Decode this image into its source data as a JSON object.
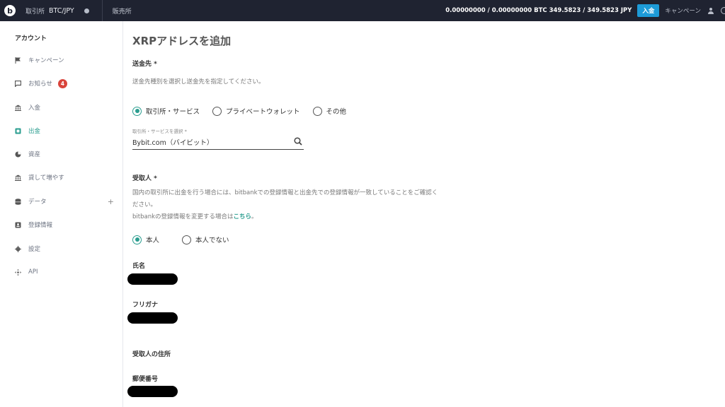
{
  "topbar": {
    "exchange_label": "取引所",
    "pair": "BTC/JPY",
    "store_label": "販売所",
    "balance": "0.00000000 / 0.00000000 BTC  349.5823 / 349.5823 JPY",
    "deposit_button": "入金",
    "campaign": "キャンペーン"
  },
  "sidebar": {
    "heading": "アカウント",
    "items": [
      {
        "label": "キャンペーン",
        "icon": "flag-icon"
      },
      {
        "label": "お知らせ",
        "icon": "message-icon",
        "badge": "4"
      },
      {
        "label": "入金",
        "icon": "bank-icon"
      },
      {
        "label": "出金",
        "icon": "withdraw-icon",
        "active": true
      },
      {
        "label": "資産",
        "icon": "pie-chart-icon"
      },
      {
        "label": "貸して増やす",
        "icon": "bank-icon"
      },
      {
        "label": "データ",
        "icon": "database-icon",
        "expand": "+"
      },
      {
        "label": "登録情報",
        "icon": "id-card-icon"
      },
      {
        "label": "設定",
        "icon": "gear-icon"
      },
      {
        "label": "API",
        "icon": "api-icon"
      }
    ]
  },
  "main": {
    "title": "XRPアドレスを追加",
    "destination": {
      "label": "送金先 *",
      "hint": "送金先種別を選択し送金先を指定してください。",
      "options": [
        "取引所・サービス",
        "プライベートウォレット",
        "その他"
      ],
      "selected": "取引所・サービス",
      "select_label": "取引所・サービスを選択 *",
      "select_value": "Bybit.com（バイビット）"
    },
    "recipient": {
      "label": "受取人 *",
      "hint_line1": "国内の取引所に出金を行う場合には、bitbankでの登録情報と出金先での登録情報が一致していることをご確認く",
      "hint_line2": "ださい。",
      "hint_line3_prefix": "bitbankの登録情報を変更する場合は",
      "hint_link": "こちら",
      "hint_line3_suffix": "。",
      "options": [
        "本人",
        "本人でない"
      ],
      "selected": "本人"
    },
    "name_label": "氏名",
    "kana_label": "フリガナ",
    "address_heading": "受取人の住所",
    "postal_label": "郵便番号"
  },
  "colors": {
    "accent": "#2a9d8f",
    "topbar": "#1f2331",
    "badge": "#d9443b",
    "deposit": "#1d9bd8"
  }
}
